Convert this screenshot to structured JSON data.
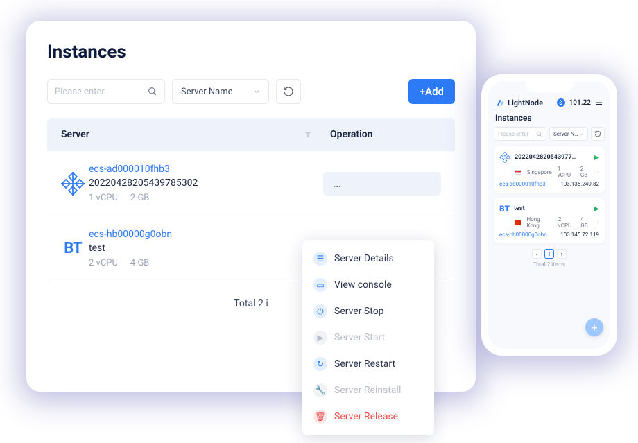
{
  "desktop": {
    "title": "Instances",
    "search_placeholder": "Please enter",
    "filter_label": "Server Name",
    "add_label": "+Add",
    "columns": {
      "server": "Server",
      "operation": "Operation"
    },
    "rows": [
      {
        "icon": "centos",
        "code": "ecs-ad000010fhb3",
        "name": "20220428205439785302",
        "vcpu": "1 vCPU",
        "ram": "2 GB"
      },
      {
        "icon": "bt",
        "code": "ecs-hb00000g0obn",
        "name": "test",
        "vcpu": "2 vCPU",
        "ram": "4 GB"
      }
    ],
    "total_line": "Total 2 i"
  },
  "menu": {
    "items": [
      {
        "icon": "details",
        "label": "Server Details",
        "state": "normal"
      },
      {
        "icon": "console",
        "label": "View console",
        "state": "normal"
      },
      {
        "icon": "power",
        "label": "Server Stop",
        "state": "normal"
      },
      {
        "icon": "play",
        "label": "Server Start",
        "state": "disabled"
      },
      {
        "icon": "restart",
        "label": "Server Restart",
        "state": "normal"
      },
      {
        "icon": "wrench",
        "label": "Server Reinstall",
        "state": "disabled"
      },
      {
        "icon": "trash",
        "label": "Server Release",
        "state": "danger"
      }
    ]
  },
  "phone": {
    "brand": "LightNode",
    "balance": "101.22",
    "title": "Instances",
    "search_placeholder": "Please enter",
    "filter_label": "Server N…",
    "cards": [
      {
        "icon": "centos",
        "name": "2022042820543977…",
        "region": "Singapore",
        "flag": "sg",
        "vcpu": "1 vCPU",
        "ram": "2 GB",
        "code": "ecs-ad000010fhb3",
        "ip": "103.136.249.82"
      },
      {
        "icon": "bt",
        "name": "test",
        "region": "Hong Kong",
        "flag": "hk",
        "vcpu": "2 vCPU",
        "ram": "4 GB",
        "code": "ecs-hb00000g0obn",
        "ip": "103.145.72.119"
      }
    ],
    "page_current": "1",
    "total": "Total 2 items"
  }
}
